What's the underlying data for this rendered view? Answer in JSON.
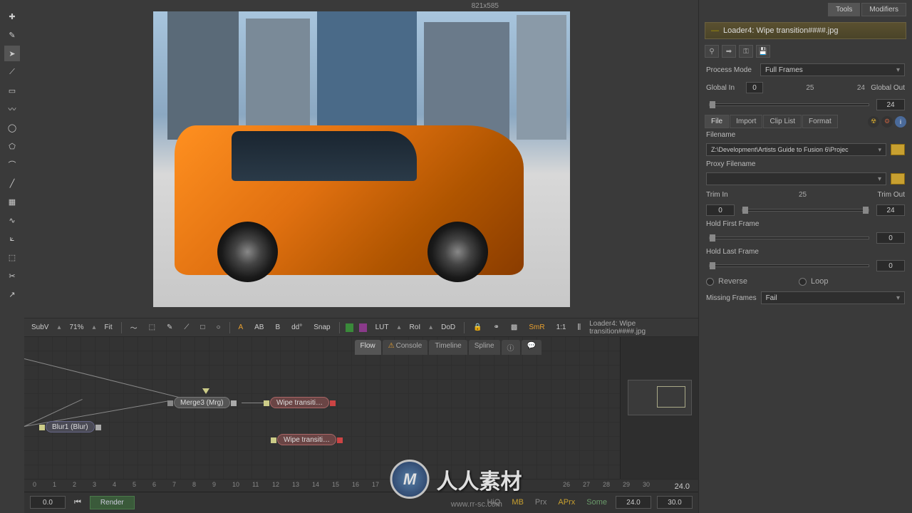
{
  "viewer": {
    "dimensions": "821x585",
    "toolbar": {
      "sub": "SubV",
      "zoom": "71%",
      "fit": "Fit",
      "a": "A",
      "ab": "AB",
      "b": "B",
      "dd": "dd°",
      "snap": "Snap",
      "lut": "LUT",
      "roi": "RoI",
      "dod": "DoD",
      "smr": "SmR",
      "scale": "1:1",
      "status": "Loader4: Wipe transition####.jpg"
    }
  },
  "flow": {
    "tabs": {
      "flow": "Flow",
      "console": "Console",
      "timeline": "Timeline",
      "spline": "Spline"
    },
    "nodes": {
      "merge3": "Merge3  (Mrg)",
      "blur1": "Blur1  (Blur)",
      "wipe1": "Wipe transiti…",
      "wipe2": "Wipe transiti…"
    }
  },
  "timeline": {
    "ticks": [
      "0",
      "1",
      "2",
      "3",
      "4",
      "5",
      "6",
      "7",
      "8",
      "9",
      "10",
      "11",
      "12",
      "13",
      "14",
      "15",
      "16",
      "17",
      "26",
      "27",
      "28",
      "29",
      "30"
    ],
    "start": "0.0",
    "end": "24.0",
    "end2": "24.0",
    "range_end": "30.0",
    "render": "Render",
    "hiq": "HiQ",
    "mb": "MB",
    "prx": "Prx",
    "aprx": "APrx",
    "some": "Some"
  },
  "panel": {
    "tabs": {
      "tools": "Tools",
      "modifiers": "Modifiers"
    },
    "header": "Loader4: Wipe transition####.jpg",
    "process_mode": {
      "label": "Process Mode",
      "value": "Full Frames"
    },
    "global_in": {
      "label": "Global In",
      "value": "0"
    },
    "global_center": "25",
    "global_out": {
      "label": "Global Out",
      "value": "24"
    },
    "global_out_val": "24",
    "file_tabs": {
      "file": "File",
      "import": "Import",
      "cliplist": "Clip List",
      "format": "Format"
    },
    "filename": {
      "label": "Filename",
      "value": "Z:\\Development\\Artists Guide to Fusion 6\\Projec"
    },
    "proxy": {
      "label": "Proxy Filename",
      "value": ""
    },
    "trim_in": {
      "label": "Trim In",
      "value": "0"
    },
    "trim_center": "25",
    "trim_out": {
      "label": "Trim Out",
      "value": "24"
    },
    "hold_first": {
      "label": "Hold First Frame",
      "value": "0"
    },
    "hold_last": {
      "label": "Hold Last Frame",
      "value": "0"
    },
    "reverse": "Reverse",
    "loop": "Loop",
    "missing": {
      "label": "Missing Frames",
      "value": "Fail"
    }
  },
  "watermark": {
    "logo": "M",
    "text": "人人素材",
    "url": "www.rr-sc.com"
  }
}
